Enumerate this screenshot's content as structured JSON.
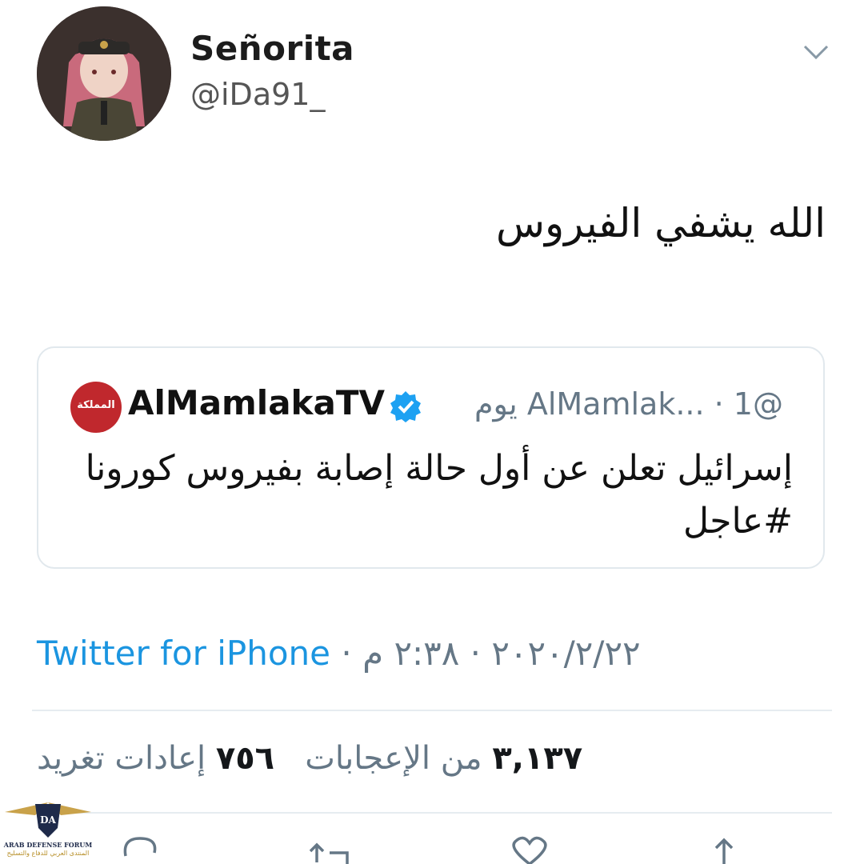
{
  "author": {
    "display_name": "Señorita",
    "handle": "@iDa91_"
  },
  "tweet": {
    "text": "الله يشفي الفيروس"
  },
  "quoted_tweet": {
    "logo_text": "المملكة",
    "name": "AlMamlakaTV",
    "handle_and_time": "@AlMamlak... · 1 يوم",
    "text": "إسرائيل تعلن عن أول حالة إصابة بفيروس كورونا #عاجل"
  },
  "meta": {
    "time": "٢:٣٨ م",
    "date": "٢٠٢٠/٢/٢٢",
    "separator": "·",
    "source": "Twitter for iPhone"
  },
  "stats": {
    "retweets_count": "٧٥٦",
    "retweets_label": "إعادات تغريد",
    "likes_count": "٣,١٣٧",
    "likes_label": "من الإعجابات"
  },
  "actions": [
    "reply-icon",
    "retweet-icon",
    "like-icon",
    "share-icon"
  ],
  "watermark": {
    "badge": "DA",
    "line1": "ARAB DEFENSE FORUM",
    "line2": "المنتدى العربي للدفاع والتسليح"
  },
  "colors": {
    "link": "#1b95e0",
    "secondary": "#657786",
    "verified": "#1da1f2",
    "brand_red": "#c0282d"
  }
}
